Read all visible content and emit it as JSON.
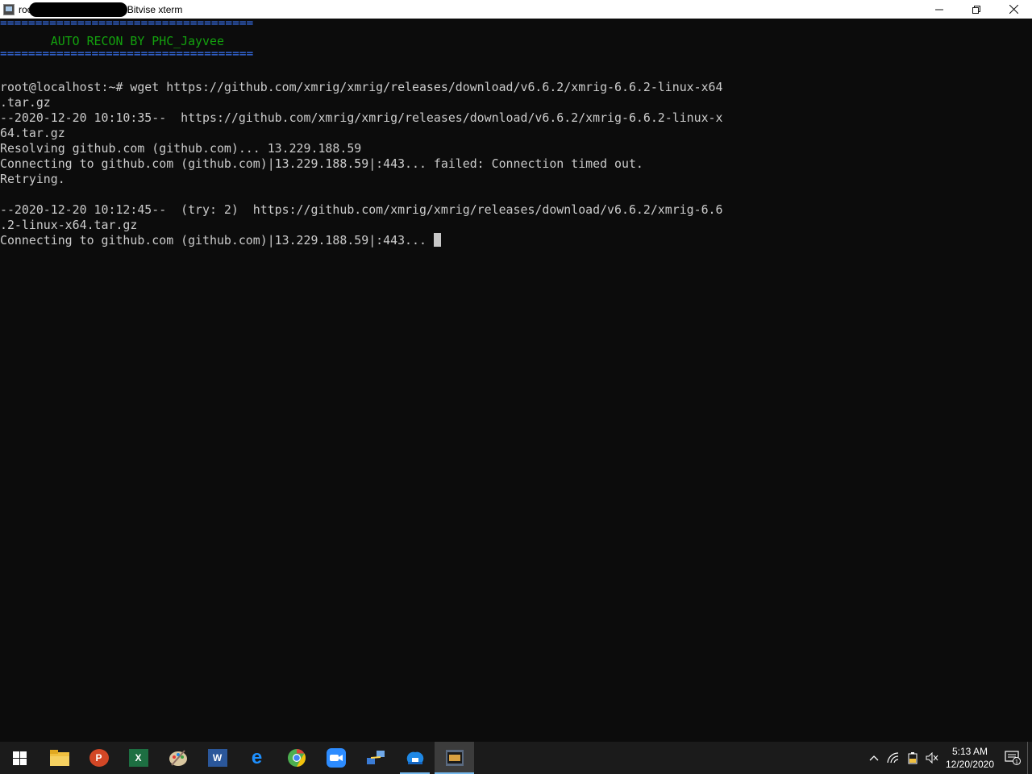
{
  "window": {
    "title_user": "root",
    "title_app": "Bitvise xterm",
    "controls": {
      "minimize": "─",
      "restore": "❐",
      "close": "✕"
    }
  },
  "terminal": {
    "banner_rule_top": "====================================",
    "banner_text": "       AUTO RECON BY PHC_Jayvee",
    "banner_rule_bottom": "====================================",
    "lines": [
      "",
      "root@localhost:~# wget https://github.com/xmrig/xmrig/releases/download/v6.6.2/xmrig-6.6.2-linux-x64",
      ".tar.gz",
      "--2020-12-20 10:10:35--  https://github.com/xmrig/xmrig/releases/download/v6.6.2/xmrig-6.6.2-linux-x",
      "64.tar.gz",
      "Resolving github.com (github.com)... 13.229.188.59",
      "Connecting to github.com (github.com)|13.229.188.59|:443... failed: Connection timed out.",
      "Retrying.",
      "",
      "--2020-12-20 10:12:45--  (try: 2)  https://github.com/xmrig/xmrig/releases/download/v6.6.2/xmrig-6.6",
      ".2-linux-x64.tar.gz"
    ],
    "current_line": "Connecting to github.com (github.com)|13.229.188.59|:443... "
  },
  "taskbar": {
    "apps": [
      {
        "name": "file-explorer-icon",
        "glyph": "",
        "color": "#f0c040"
      },
      {
        "name": "powerpoint-icon",
        "glyph": "P",
        "color": "#d24726"
      },
      {
        "name": "excel-icon",
        "glyph": "X",
        "color": "#1d6f42"
      },
      {
        "name": "paint-icon",
        "glyph": "",
        "color": "#c8a070"
      },
      {
        "name": "word-icon",
        "glyph": "W",
        "color": "#2b579a"
      },
      {
        "name": "edge-icon",
        "glyph": "e",
        "color": "#0078d7"
      },
      {
        "name": "chrome-icon",
        "glyph": "",
        "color": "#4caf50"
      },
      {
        "name": "zoom-icon",
        "glyph": "",
        "color": "#2d8cff"
      },
      {
        "name": "network-tool-icon",
        "glyph": "",
        "color": "#3a7bd5"
      },
      {
        "name": "vpn-icon",
        "glyph": "",
        "color": "#1e88e5"
      },
      {
        "name": "bitvise-xterm-icon",
        "glyph": "",
        "color": "#5a6a80"
      }
    ],
    "tray": {
      "chevron": "^",
      "wifi": "wifi",
      "battery": "battery",
      "volume": "🔇",
      "time": "5:13 AM",
      "date": "12/20/2020",
      "notifications": "1"
    }
  }
}
